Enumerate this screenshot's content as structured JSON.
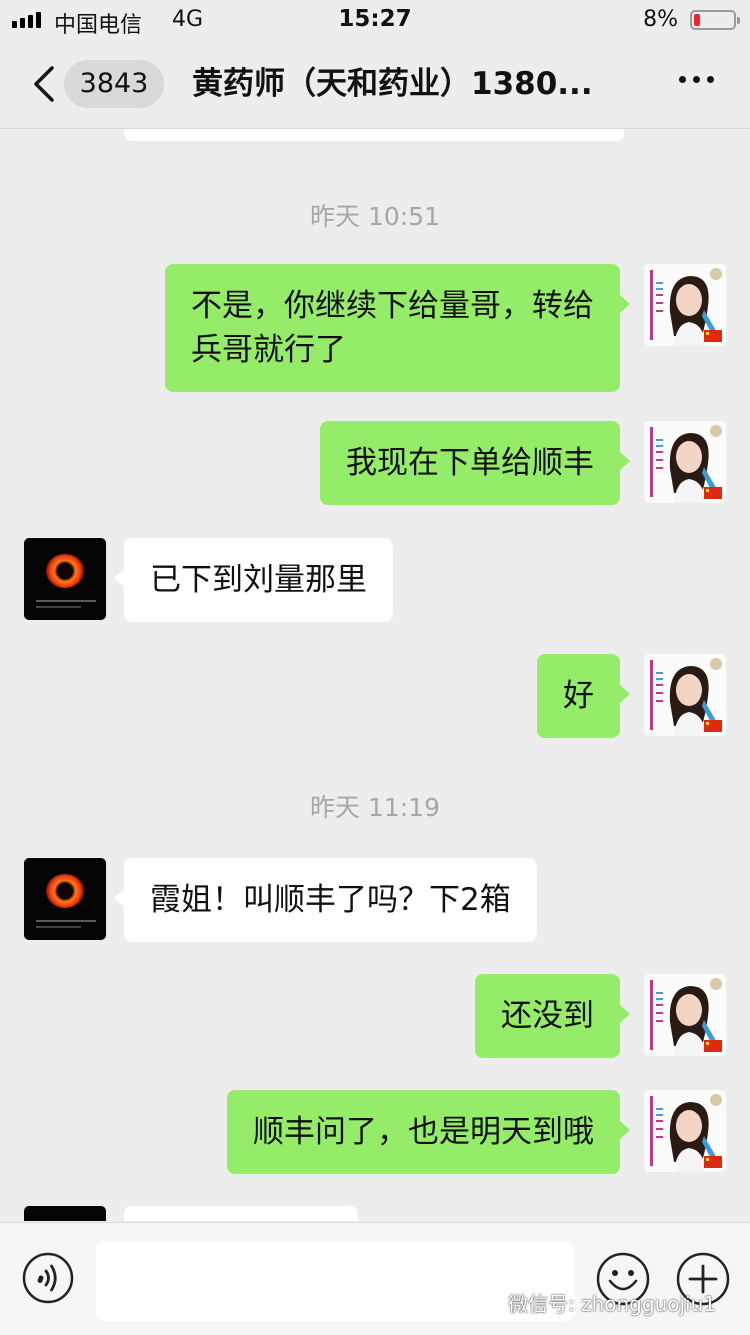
{
  "status_bar": {
    "carrier": "中国电信",
    "network": "4G",
    "time": "15:27",
    "battery_percent": "8%",
    "battery_level": 0.08
  },
  "header": {
    "unread_count": "3843",
    "title": "黄药师（天和药业）1380..."
  },
  "messages": [
    {
      "type": "time",
      "text": "昨天 10:51"
    },
    {
      "type": "msg",
      "from": "self",
      "lines": [
        "不是，你继续下给量哥，转给",
        "兵哥就行了"
      ]
    },
    {
      "type": "msg",
      "from": "self",
      "lines": [
        "我现在下单给顺丰"
      ]
    },
    {
      "type": "msg",
      "from": "other",
      "lines": [
        "已下到刘量那里"
      ]
    },
    {
      "type": "msg",
      "from": "self",
      "lines": [
        "好"
      ]
    },
    {
      "type": "time",
      "text": "昨天 11:19"
    },
    {
      "type": "msg",
      "from": "other",
      "lines": [
        "霞姐！叫顺丰了吗？下2箱"
      ]
    },
    {
      "type": "msg",
      "from": "self",
      "lines": [
        "还没到"
      ]
    },
    {
      "type": "msg",
      "from": "self",
      "lines": [
        "顺丰问了，也是明天到哦"
      ]
    }
  ],
  "input": {
    "value": ""
  },
  "watermark": "微信号: zhongguojiu1",
  "icons": [
    "back-icon",
    "more-icon",
    "voice-icon",
    "emoji-icon",
    "plus-icon",
    "signal-icon",
    "battery-icon"
  ],
  "colors": {
    "outgoing_bubble": "#95ec69",
    "incoming_bubble": "#ffffff",
    "background": "#ededed"
  }
}
